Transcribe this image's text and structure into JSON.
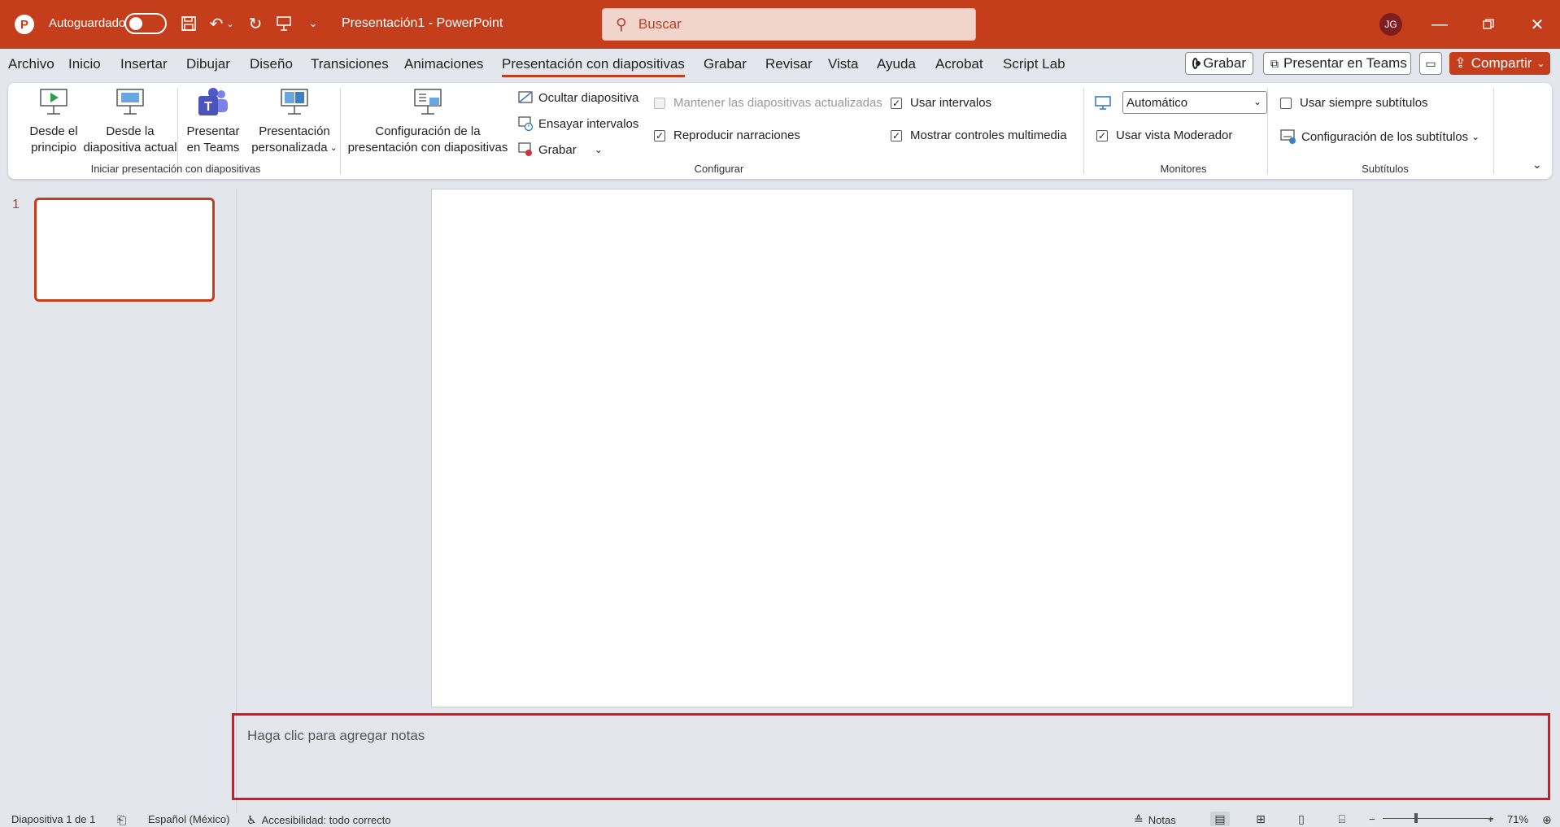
{
  "titlebar": {
    "autosave_label": "Autoguardado",
    "doc_title": "Presentación1  -  PowerPoint",
    "search_placeholder": "Buscar",
    "avatar_initials": "JG",
    "accent_color": "#c43e1c"
  },
  "tabs": [
    {
      "label": "Archivo"
    },
    {
      "label": "Inicio"
    },
    {
      "label": "Insertar"
    },
    {
      "label": "Dibujar"
    },
    {
      "label": "Diseño"
    },
    {
      "label": "Transiciones"
    },
    {
      "label": "Animaciones"
    },
    {
      "label": "Presentación con diapositivas",
      "active": true
    },
    {
      "label": "Grabar"
    },
    {
      "label": "Revisar"
    },
    {
      "label": "Vista"
    },
    {
      "label": "Ayuda"
    },
    {
      "label": "Acrobat"
    },
    {
      "label": "Script Lab"
    }
  ],
  "tab_actions": {
    "record": "Grabar",
    "present_teams": "Presentar en Teams",
    "share": "Compartir"
  },
  "ribbon": {
    "start_group": {
      "label": "Iniciar presentación con diapositivas",
      "from_start": [
        "Desde el",
        "principio"
      ],
      "from_current": [
        "Desde la",
        "diapositiva actual"
      ],
      "present_teams": [
        "Presentar",
        "en Teams"
      ],
      "custom_show": [
        "Presentación",
        "personalizada"
      ]
    },
    "setup_group": {
      "label": "Configurar",
      "setup_show": [
        "Configuración de la",
        "presentación con diapositivas"
      ],
      "hide_slide": "Ocultar diapositiva",
      "rehearse": "Ensayar intervalos",
      "record": "Grabar",
      "keep_updated": "Mantener las diapositivas actualizadas",
      "play_narrations": "Reproducir narraciones",
      "use_timings": "Usar intervalos",
      "show_media_controls": "Mostrar controles multimedia"
    },
    "monitors_group": {
      "label": "Monitores",
      "monitor_value": "Automático",
      "presenter_view": "Usar vista Moderador"
    },
    "captions_group": {
      "label": "Subtítulos",
      "always_subtitles": "Usar siempre subtítulos",
      "subtitle_settings": "Configuración de los subtítulos"
    }
  },
  "thumbnails": {
    "slide_number": "1"
  },
  "notes": {
    "placeholder": "Haga clic para agregar notas"
  },
  "statusbar": {
    "slide_info": "Diapositiva 1 de 1",
    "language": "Español (México)",
    "accessibility": "Accesibilidad: todo correcto",
    "notes": "Notas",
    "zoom_out": "−",
    "zoom_in": "+",
    "zoom": "71%"
  }
}
